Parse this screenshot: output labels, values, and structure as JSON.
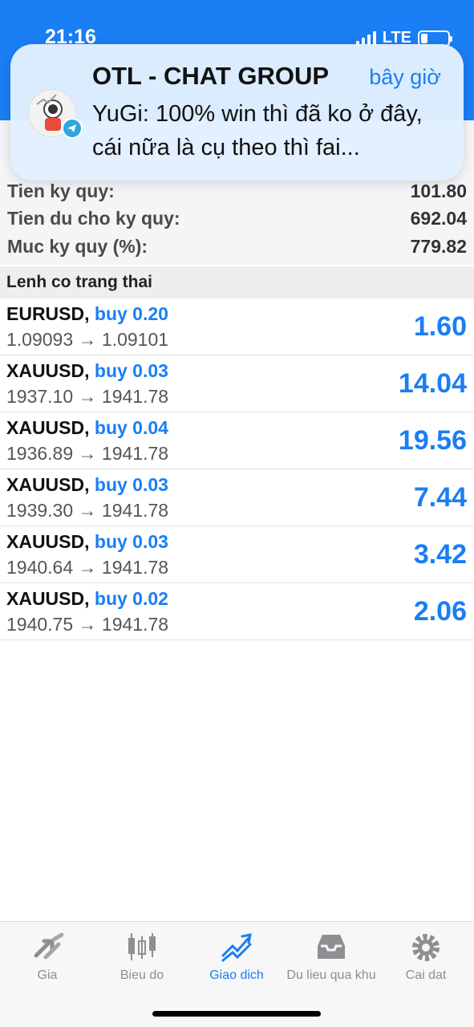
{
  "status": {
    "time": "21:16",
    "network": "LTE"
  },
  "notification": {
    "app_title": "OTL - CHAT GROUP",
    "time": "bây giờ",
    "message": "YuGi: 100% win thì đã ko ở đây, cái nữa là cụ theo thì fai..."
  },
  "account": [
    {
      "label": "Tien ky quy:",
      "value": "101.80"
    },
    {
      "label": "Tien du cho ky quy:",
      "value": "692.04"
    },
    {
      "label": "Muc ky quy (%):",
      "value": "779.82"
    }
  ],
  "section_title": "Lenh co trang thai",
  "orders": [
    {
      "symbol": "EURUSD,",
      "side": "buy 0.20",
      "price": "1.09093 → 1.09101",
      "profit": "1.60"
    },
    {
      "symbol": "XAUUSD,",
      "side": "buy 0.03",
      "price": "1937.10 → 1941.78",
      "profit": "14.04"
    },
    {
      "symbol": "XAUUSD,",
      "side": "buy 0.04",
      "price": "1936.89 → 1941.78",
      "profit": "19.56"
    },
    {
      "symbol": "XAUUSD,",
      "side": "buy 0.03",
      "price": "1939.30 → 1941.78",
      "profit": "7.44"
    },
    {
      "symbol": "XAUUSD,",
      "side": "buy 0.03",
      "price": "1940.64 → 1941.78",
      "profit": "3.42"
    },
    {
      "symbol": "XAUUSD,",
      "side": "buy 0.02",
      "price": "1940.75 → 1941.78",
      "profit": "2.06"
    }
  ],
  "tabs": [
    {
      "label": "Gia",
      "icon": "arrows-icon"
    },
    {
      "label": "Bieu do",
      "icon": "candlestick-icon"
    },
    {
      "label": "Giao dich",
      "icon": "trend-icon",
      "active": true
    },
    {
      "label": "Du lieu qua khu",
      "icon": "inbox-icon"
    },
    {
      "label": "Cai dat",
      "icon": "gear-icon"
    }
  ],
  "colors": {
    "accent": "#1a7ef5",
    "header": "#1a7ef5",
    "telegram": "#2ea6df"
  }
}
